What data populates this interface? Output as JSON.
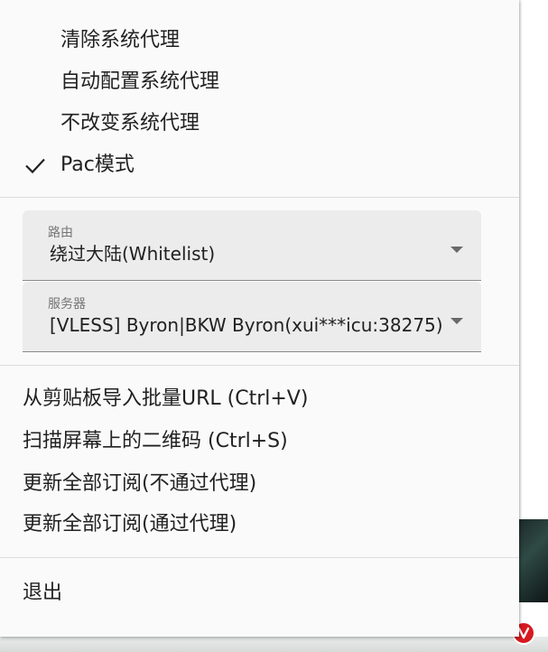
{
  "proxy_modes": [
    {
      "label": "清除系统代理",
      "checked": false
    },
    {
      "label": "自动配置系统代理",
      "checked": false
    },
    {
      "label": "不改变系统代理",
      "checked": false
    },
    {
      "label": "Pac模式",
      "checked": true
    }
  ],
  "routing": {
    "label": "路由",
    "value": "绕过大陆(Whitelist)"
  },
  "server": {
    "label": "服务器",
    "value": "[VLESS] Byron|BKW Byron(xui***icu:38275)"
  },
  "actions": [
    {
      "label": "从剪贴板导入批量URL (Ctrl+V)"
    },
    {
      "label": "扫描屏幕上的二维码 (Ctrl+S)"
    },
    {
      "label": "更新全部订阅(不通过代理)"
    },
    {
      "label": "更新全部订阅(通过代理)"
    }
  ],
  "exit_label": "退出",
  "colors": {
    "menu_background": "#fafafa",
    "field_background": "#ececec",
    "text": "#212121",
    "tray_icon": "#d7191f"
  },
  "icons": {
    "check": "check-icon",
    "dropdown": "dropdown-arrow-icon",
    "tray": "v2rayn-tray-icon"
  }
}
